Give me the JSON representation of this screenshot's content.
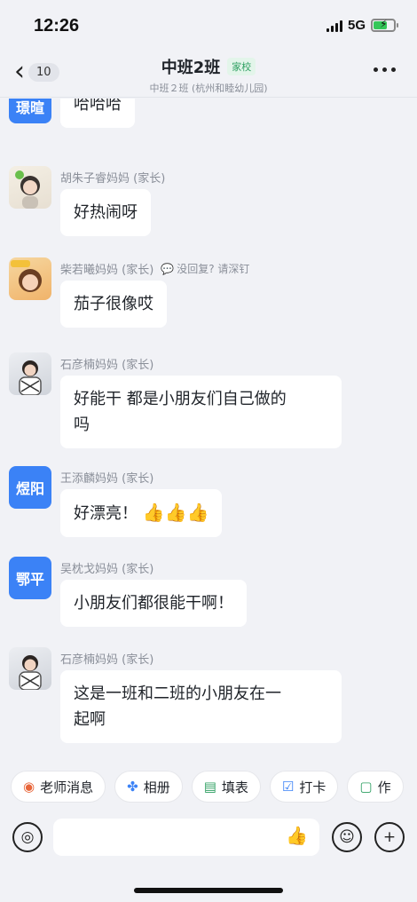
{
  "status_bar": {
    "time": "12:26",
    "network": "5G"
  },
  "header": {
    "unread_count": "10",
    "title": "中班2班",
    "tag": "家校",
    "subtitle": "中班２班 (杭州和睦幼儿园)"
  },
  "messages": [
    {
      "avatar_text": "璟暄",
      "sender": "",
      "text": "哈哈哈"
    },
    {
      "avatar_text": "",
      "sender": "胡朱子睿妈妈 (家长)",
      "text": "好热闹呀"
    },
    {
      "avatar_text": "",
      "sender": "柴若曦妈妈 (家长)",
      "reply_hint": "没回复? 请深钉",
      "text": "茄子很像哎"
    },
    {
      "avatar_text": "",
      "sender": "石彦楠妈妈 (家长)",
      "text_line1": "好能干  都是小朋友们自己做的",
      "text_line2": "吗"
    },
    {
      "avatar_text": "煜阳",
      "sender": "王添麟妈妈 (家长)",
      "text": "好漂亮！"
    },
    {
      "avatar_text": "鄂平",
      "sender": "吴枕戈妈妈 (家长)",
      "text": "小朋友们都很能干啊！"
    },
    {
      "avatar_text": "",
      "sender": "石彦楠妈妈 (家长)",
      "text_line1": "这是一班和二班的小朋友在一",
      "text_line2": "起啊"
    }
  ],
  "quick_actions": [
    {
      "label": "老师消息",
      "icon": "teacher-icon"
    },
    {
      "label": "相册",
      "icon": "pinwheel-icon"
    },
    {
      "label": "填表",
      "icon": "form-icon"
    },
    {
      "label": "打卡",
      "icon": "checkin-icon"
    },
    {
      "label": "作",
      "icon": "homework-icon"
    }
  ],
  "colors": {
    "avatar_blue": "#3b82f6",
    "tag_green": "#2fa062",
    "accent_orange": "#e8663a"
  }
}
